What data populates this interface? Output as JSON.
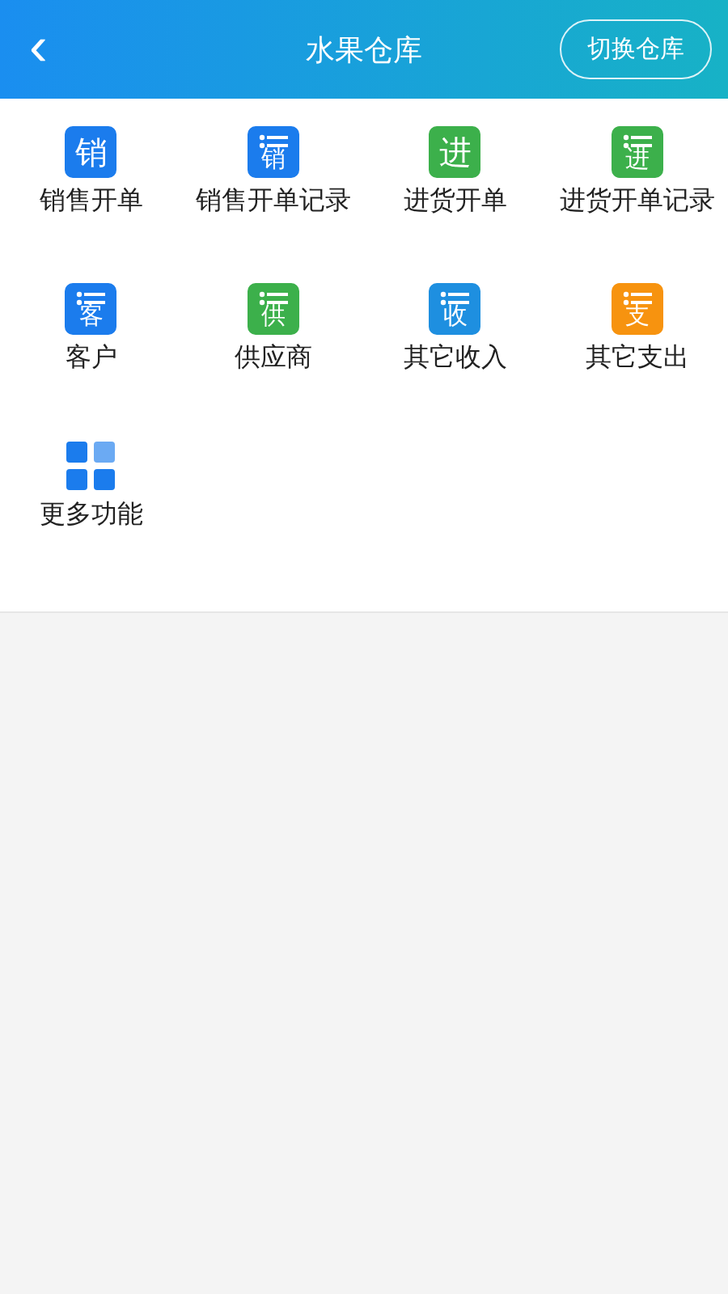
{
  "header": {
    "back_icon": "‹",
    "title": "水果仓库",
    "action": "切换仓库"
  },
  "items": [
    {
      "label": "销售开单",
      "kind": "plain",
      "glyph": "销",
      "color": "#1b7ced"
    },
    {
      "label": "销售开单记录",
      "kind": "list",
      "glyph": "销",
      "color": "#1b7ced"
    },
    {
      "label": "进货开单",
      "kind": "plain",
      "glyph": "进",
      "color": "#3cb04b"
    },
    {
      "label": "进货开单记录",
      "kind": "list",
      "glyph": "进",
      "color": "#3cb04b"
    },
    {
      "label": "客户",
      "kind": "list",
      "glyph": "客",
      "color": "#1b7ced"
    },
    {
      "label": "供应商",
      "kind": "list",
      "glyph": "供",
      "color": "#3cb04b"
    },
    {
      "label": "其它收入",
      "kind": "list",
      "glyph": "收",
      "color": "#1e8fe0"
    },
    {
      "label": "其它支出",
      "kind": "list",
      "glyph": "支",
      "color": "#f7930f"
    },
    {
      "label": "更多功能",
      "kind": "grid",
      "color": "#1b7ced"
    }
  ]
}
